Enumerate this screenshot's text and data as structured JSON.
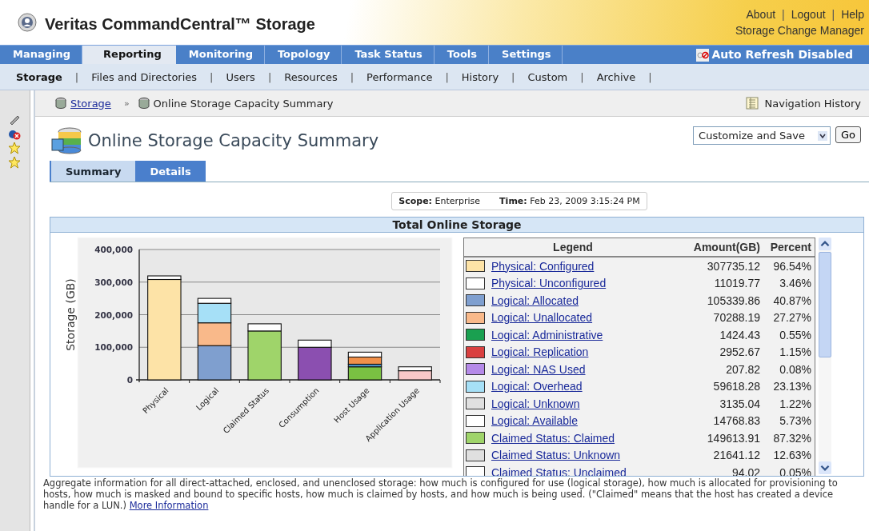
{
  "header": {
    "title": "Veritas CommandCentral™ Storage",
    "links": [
      "About",
      "Logout",
      "Help"
    ],
    "separator": "|",
    "product": "Storage Change Manager"
  },
  "main_tabs": [
    {
      "label": "Managing",
      "selected": false
    },
    {
      "label": "Reporting",
      "selected": true
    },
    {
      "label": "Monitoring",
      "selected": false
    },
    {
      "label": "Topology",
      "selected": false
    },
    {
      "label": "Task Status",
      "selected": false
    },
    {
      "label": "Tools",
      "selected": false
    },
    {
      "label": "Settings",
      "selected": false
    }
  ],
  "auto_refresh": "Auto Refresh Disabled",
  "sub_tab_separator": "|",
  "sub_tabs": [
    {
      "label": "Storage",
      "selected": true
    },
    {
      "label": "Files and Directories",
      "selected": false
    },
    {
      "label": "Users",
      "selected": false
    },
    {
      "label": "Resources",
      "selected": false
    },
    {
      "label": "Performance",
      "selected": false
    },
    {
      "label": "History",
      "selected": false
    },
    {
      "label": "Custom",
      "selected": false
    },
    {
      "label": "Archive",
      "selected": false
    }
  ],
  "breadcrumb": {
    "items": [
      {
        "label": "Storage",
        "kind": "link"
      },
      {
        "label": "Online Storage Capacity Summary",
        "kind": "current"
      }
    ],
    "separator": "»"
  },
  "navigation_history": "Navigation History",
  "page_title": "Online Storage Capacity Summary",
  "customize": {
    "value": "Customize and Save",
    "go": "Go"
  },
  "view_tabs": [
    {
      "label": "Summary",
      "selected": true
    },
    {
      "label": "Details",
      "selected": false
    }
  ],
  "scope": {
    "scope_label": "Scope:",
    "scope_value": "Enterprise",
    "time_label": "Time:",
    "time_value": "Feb 23, 2009 3:15:24 PM"
  },
  "panel_title": "Total Online Storage",
  "chart_data": {
    "type": "bar",
    "stacked": true,
    "grid": true,
    "ylabel": "Storage (GB)",
    "categories": [
      "Physical",
      "Logical",
      "Claimed Status",
      "Consumption",
      "Host Usage",
      "Application Usage"
    ],
    "ylim": [
      0,
      400000
    ],
    "yticks": [
      {
        "value": 0,
        "label": "0"
      },
      {
        "value": 100000,
        "label": "100,000"
      },
      {
        "value": 200000,
        "label": "200,000"
      },
      {
        "value": 300000,
        "label": "300,000"
      },
      {
        "value": 400000,
        "label": "400,000"
      }
    ],
    "series": [
      {
        "color": "#fde3a7",
        "values": [
          308000,
          null,
          null,
          null,
          null,
          null
        ]
      },
      {
        "color": "#ffffff",
        "values": [
          11000,
          null,
          null,
          null,
          null,
          null
        ]
      },
      {
        "color": "#7f9fcf",
        "values": [
          null,
          105000,
          null,
          null,
          null,
          null
        ]
      },
      {
        "color": "#f9b98a",
        "values": [
          null,
          70000,
          null,
          null,
          null,
          null
        ]
      },
      {
        "color": "#a6e0f7",
        "values": [
          null,
          60000,
          null,
          null,
          null,
          null
        ]
      },
      {
        "color": "#ffffff",
        "values": [
          null,
          15000,
          null,
          null,
          null,
          null
        ]
      },
      {
        "color": "#9fd46a",
        "values": [
          null,
          null,
          150000,
          null,
          null,
          null
        ]
      },
      {
        "color": "#ffffff",
        "values": [
          null,
          null,
          22000,
          null,
          null,
          null
        ]
      },
      {
        "color": "#8b4fb0",
        "values": [
          null,
          null,
          null,
          100000,
          null,
          null
        ]
      },
      {
        "color": "#7ac142",
        "values": [
          null,
          null,
          null,
          null,
          40000,
          null
        ]
      },
      {
        "color": "#ffffff",
        "values": [
          null,
          null,
          null,
          22000,
          null,
          null
        ]
      },
      {
        "color": "#4a8fc4",
        "values": [
          null,
          null,
          null,
          null,
          8000,
          null
        ]
      },
      {
        "color": "#f0904a",
        "values": [
          null,
          null,
          null,
          null,
          22000,
          null
        ]
      },
      {
        "color": "#ffffff",
        "values": [
          null,
          null,
          null,
          null,
          15000,
          null
        ]
      },
      {
        "color": "#f9c8c8",
        "values": [
          null,
          null,
          null,
          null,
          null,
          28000
        ]
      },
      {
        "color": "#ffffff",
        "values": [
          null,
          null,
          null,
          null,
          null,
          12000
        ]
      }
    ]
  },
  "legend": {
    "columns": [
      "Legend",
      "Amount(GB)",
      "Percent"
    ],
    "rows": [
      {
        "label": "Physical: Configured",
        "amount": "307735.12",
        "percent": "96.54%",
        "color": "#fde3a7"
      },
      {
        "label": "Physical: Unconfigured",
        "amount": "11019.77",
        "percent": "3.46%",
        "color": "#ffffff"
      },
      {
        "label": "Logical: Allocated",
        "amount": "105339.86",
        "percent": "40.87%",
        "color": "#7f9fcf"
      },
      {
        "label": "Logical: Unallocated",
        "amount": "70288.19",
        "percent": "27.27%",
        "color": "#f9b98a"
      },
      {
        "label": "Logical: Administrative",
        "amount": "1424.43",
        "percent": "0.55%",
        "color": "#1aa050"
      },
      {
        "label": "Logical: Replication",
        "amount": "2952.67",
        "percent": "1.15%",
        "color": "#d94040"
      },
      {
        "label": "Logical: NAS Used",
        "amount": "207.82",
        "percent": "0.08%",
        "color": "#b58ae8"
      },
      {
        "label": "Logical: Overhead",
        "amount": "59618.28",
        "percent": "23.13%",
        "color": "#a6e0f7"
      },
      {
        "label": "Logical: Unknown",
        "amount": "3135.04",
        "percent": "1.22%",
        "color": "#e0e0e0"
      },
      {
        "label": "Logical: Available",
        "amount": "14768.83",
        "percent": "5.73%",
        "color": "#ffffff"
      },
      {
        "label": "Claimed Status: Claimed",
        "amount": "149613.91",
        "percent": "87.32%",
        "color": "#9fd46a"
      },
      {
        "label": "Claimed Status: Unknown",
        "amount": "21641.12",
        "percent": "12.63%",
        "color": "#e0e0e0"
      },
      {
        "label": "Claimed Status: Unclaimed",
        "amount": "94.02",
        "percent": "0.05%",
        "color": "#ffffff"
      }
    ]
  },
  "description": {
    "text": "Aggregate information for all direct-attached, enclosed, and unenclosed storage: how much is configured for use (logical storage), how much is allocated for provisioning to hosts, how much is masked and bound to specific hosts, how much is claimed by hosts, and how much is being used. (\"Claimed\" means that the host has created a device handle for a LUN.)",
    "link": "More Information"
  }
}
